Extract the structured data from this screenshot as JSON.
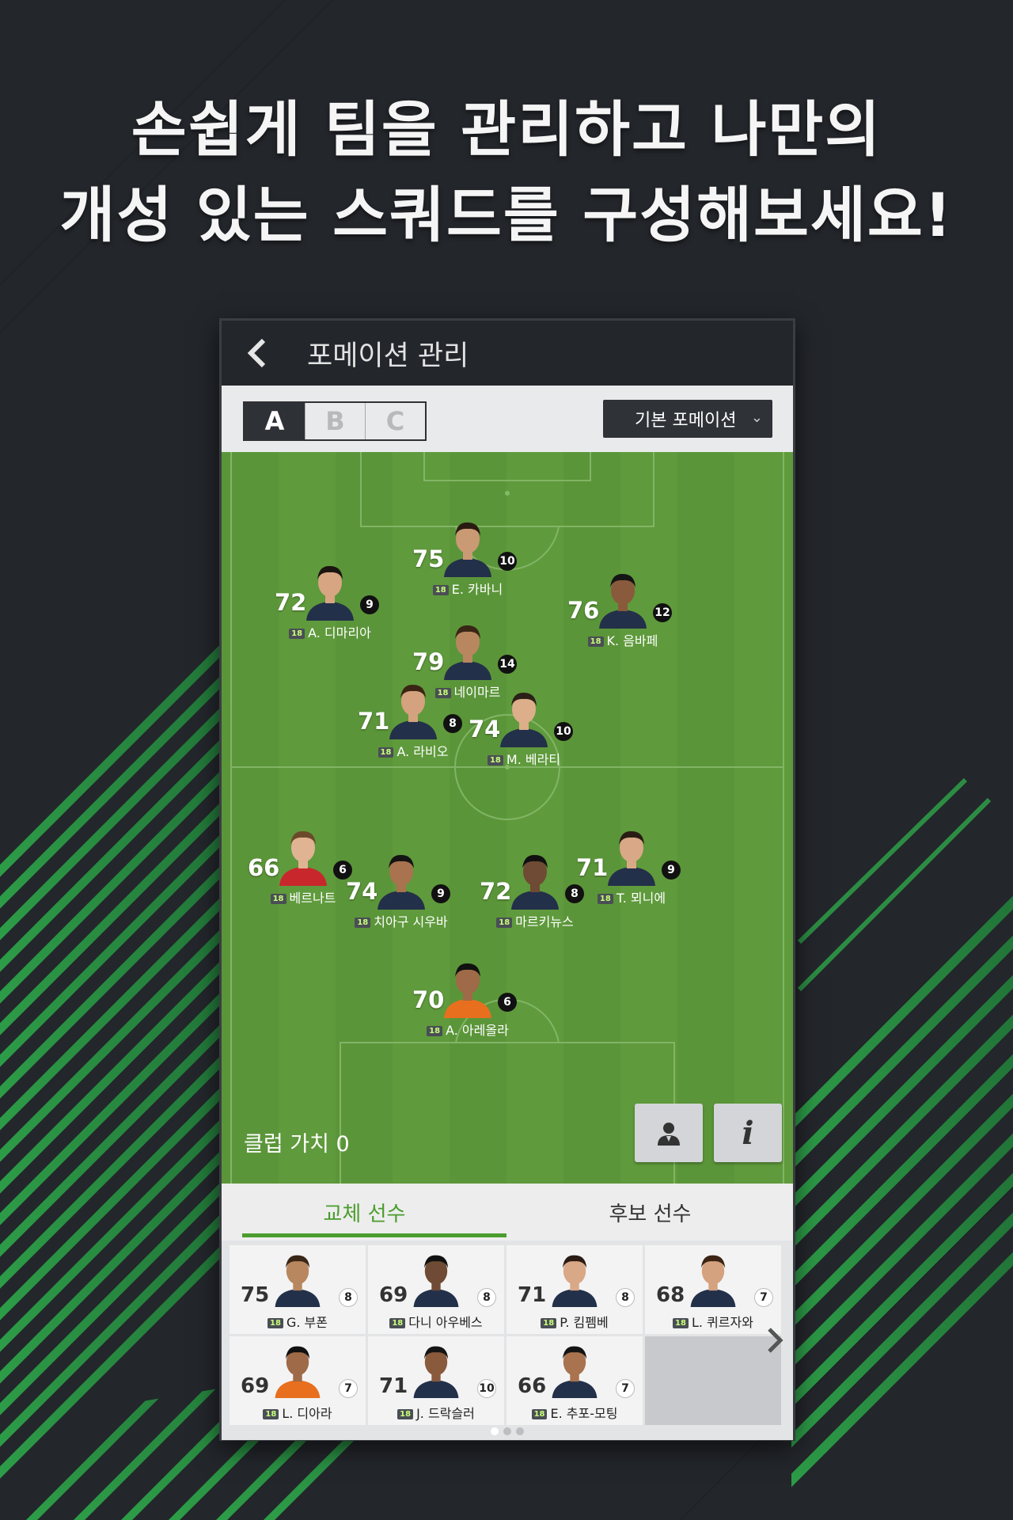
{
  "headline": {
    "line1": "손쉽게 팀을 관리하고 나만의",
    "line2": "개성 있는 스쿼드를 구성해보세요!"
  },
  "screen": {
    "title": "포메이션 관리",
    "tabs_formation": [
      "A",
      "B",
      "C"
    ],
    "formation_select": "기본 포메이션",
    "club_value": "클럽 가치 0",
    "bottom_tabs": [
      "교체 선수",
      "후보 선수"
    ],
    "active_bottom_tab": 0,
    "page_dots": 3,
    "active_page": 0
  },
  "badge_label": "18",
  "starters": [
    {
      "ovr": "75",
      "num": "10",
      "name": "E. 카바니"
    },
    {
      "ovr": "72",
      "num": "9",
      "name": "A. 디마리아"
    },
    {
      "ovr": "76",
      "num": "12",
      "name": "K. 음바페"
    },
    {
      "ovr": "79",
      "num": "14",
      "name": "네이마르"
    },
    {
      "ovr": "71",
      "num": "8",
      "name": "A. 라비오"
    },
    {
      "ovr": "74",
      "num": "10",
      "name": "M. 베라티"
    },
    {
      "ovr": "66",
      "num": "6",
      "name": "베르나트"
    },
    {
      "ovr": "74",
      "num": "9",
      "name": "치아구 시우바"
    },
    {
      "ovr": "72",
      "num": "8",
      "name": "마르키뉴스"
    },
    {
      "ovr": "71",
      "num": "9",
      "name": "T. 뫼니에"
    },
    {
      "ovr": "70",
      "num": "6",
      "name": "A. 아레올라"
    }
  ],
  "substitutes": [
    {
      "ovr": "75",
      "num": "8",
      "name": "G. 부폰"
    },
    {
      "ovr": "69",
      "num": "8",
      "name": "다니 아우베스"
    },
    {
      "ovr": "71",
      "num": "8",
      "name": "P. 킴펨베"
    },
    {
      "ovr": "68",
      "num": "7",
      "name": "L. 퀴르자와"
    },
    {
      "ovr": "69",
      "num": "7",
      "name": "L. 디아라"
    },
    {
      "ovr": "71",
      "num": "10",
      "name": "J. 드락슬러"
    },
    {
      "ovr": "66",
      "num": "7",
      "name": "E. 추포-모팅"
    }
  ],
  "colors": {
    "background": "#23262b",
    "accent_green": "#4a9d2d",
    "pitch_green": "#5f9a3c"
  },
  "icons": [
    "back-arrow-icon",
    "chevron-down-icon",
    "person-icon",
    "info-icon",
    "chevron-right-icon"
  ]
}
